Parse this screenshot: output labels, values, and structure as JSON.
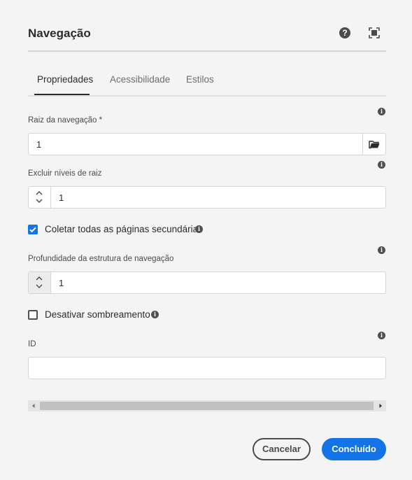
{
  "dialog": {
    "title": "Navegação",
    "help_glyph": "?",
    "icons": {
      "help": "help-circle-icon",
      "fullscreen": "fullscreen-icon"
    }
  },
  "tabs": [
    {
      "label": "Propriedades",
      "active": true
    },
    {
      "label": "Acessibilidade",
      "active": false
    },
    {
      "label": "Estilos",
      "active": false
    }
  ],
  "info_glyph": "i",
  "fields": {
    "root": {
      "label": "Raiz da navegação *",
      "value": "1",
      "browse_icon": "folder-open-icon"
    },
    "exclude_levels": {
      "label": "Excluir níveis de raiz",
      "value": "1"
    },
    "collect_all": {
      "label": "Coletar todas as páginas secundárias",
      "checked": true
    },
    "structure_depth": {
      "label": "Profundidade da estrutura de navegação",
      "value": "1"
    },
    "disable_shadowing": {
      "label": "Desativar sombreamento",
      "checked": false
    },
    "id": {
      "label": "ID",
      "value": ""
    }
  },
  "actions": {
    "cancel": "Cancelar",
    "done": "Concluído"
  },
  "colors": {
    "accent": "#1473e6",
    "background": "#f4f4f4",
    "text": "#2c2c2c"
  }
}
